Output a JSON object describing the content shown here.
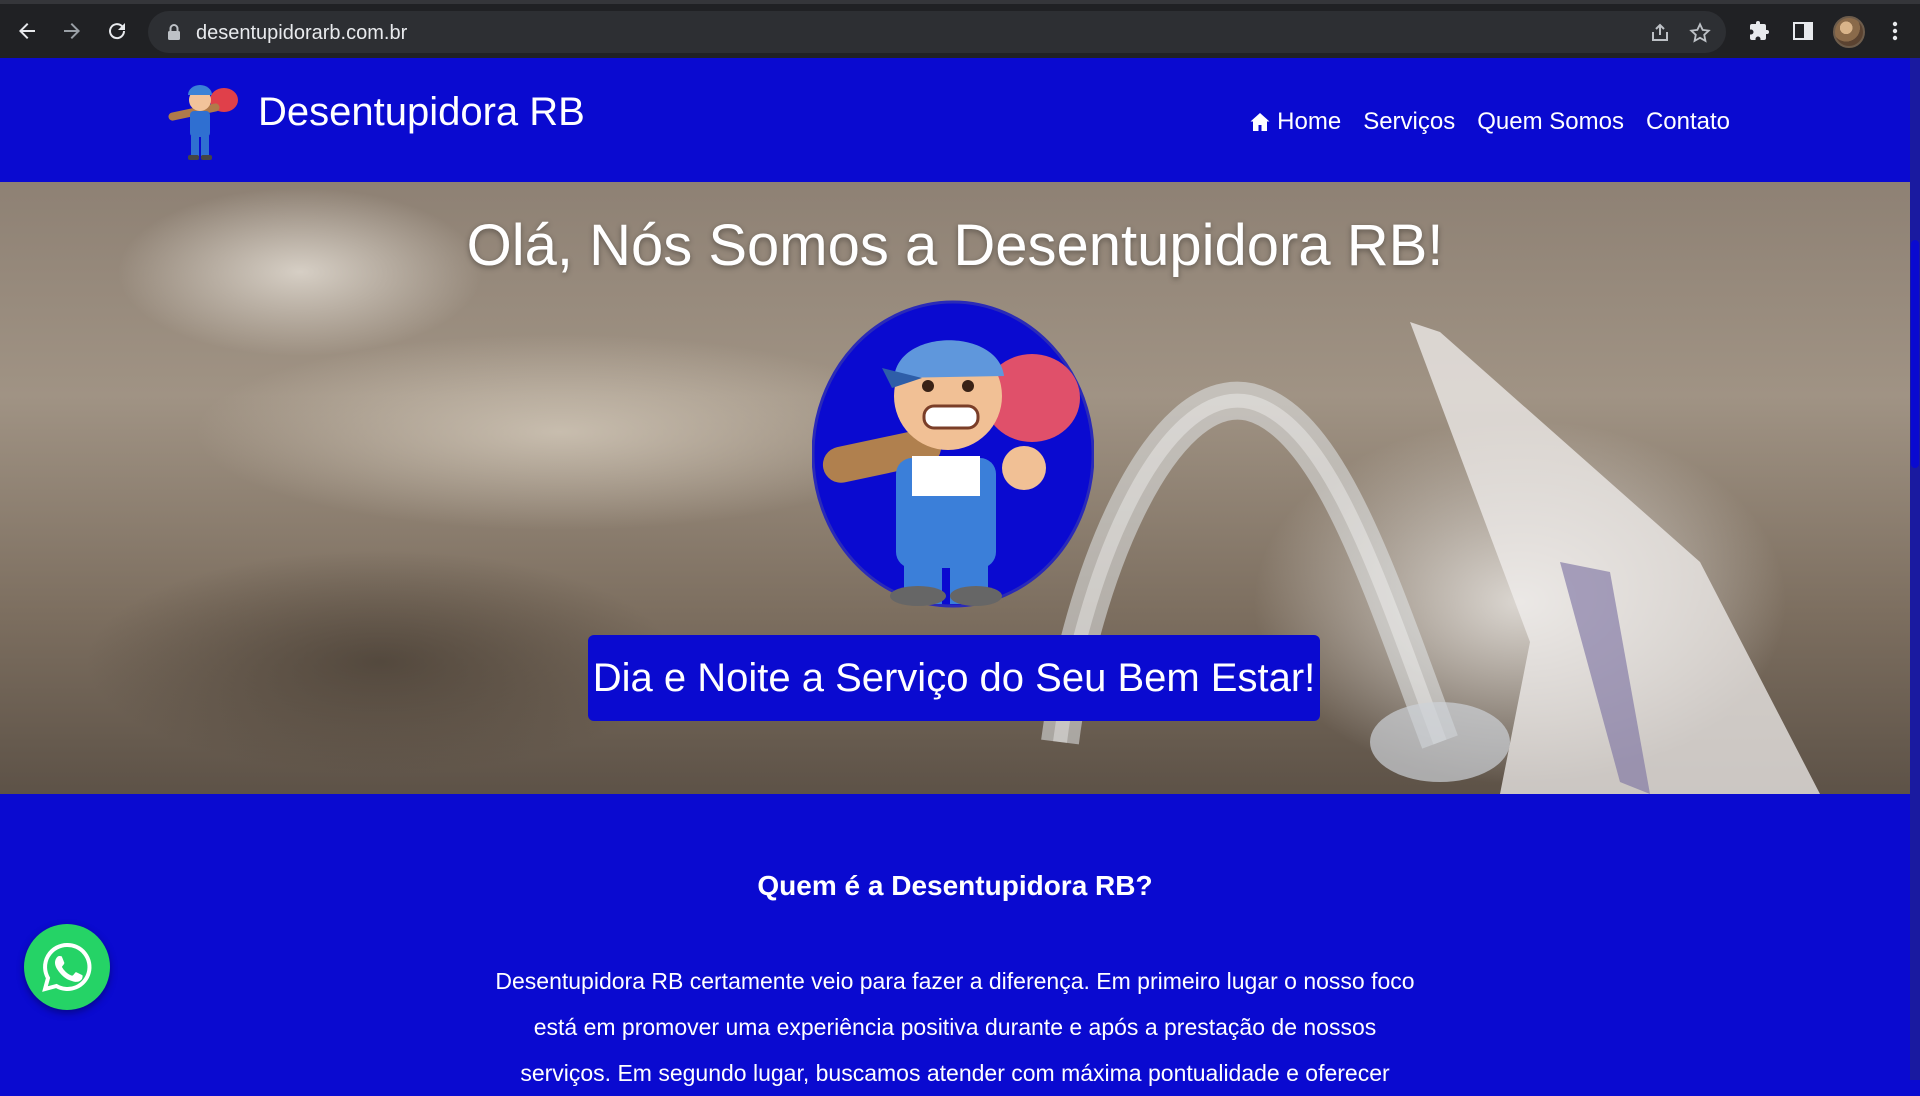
{
  "browser": {
    "url": "desentupidorarb.com.br",
    "icons": [
      "back-icon",
      "forward-icon",
      "reload-icon",
      "lock-icon",
      "share-icon",
      "star-icon",
      "extensions-icon",
      "side-panel-icon",
      "profile-avatar",
      "menu-icon"
    ]
  },
  "header": {
    "brand": "Desentupidora RB",
    "nav": [
      {
        "label": "Home",
        "icon": "home-icon"
      },
      {
        "label": "Serviços"
      },
      {
        "label": "Quem Somos"
      },
      {
        "label": "Contato"
      }
    ]
  },
  "hero": {
    "title": "Olá, Nós Somos a Desentupidora RB!",
    "tagline": "Dia e Noite a Serviço do Seu Bem Estar!"
  },
  "about": {
    "title": "Quem é a Desentupidora RB?",
    "lines": [
      "Desentupidora RB certamente veio para fazer a diferença. Em primeiro lugar o nosso foco",
      "está em promover uma experiência positiva durante e após a prestação de nossos",
      "serviços. Em segundo lugar, buscamos atender com máxima pontualidade e oferecer"
    ]
  },
  "floating": {
    "whatsapp_icon": "whatsapp-icon"
  },
  "colors": {
    "brand_blue": "#0a0ad0",
    "whatsapp_green": "#25d366",
    "chrome_dark": "#202124"
  }
}
